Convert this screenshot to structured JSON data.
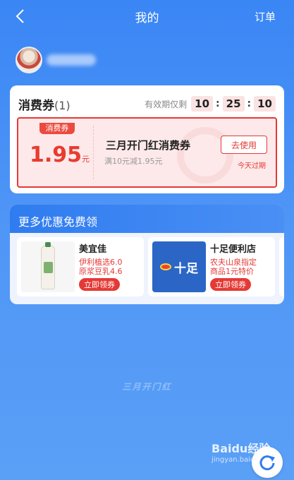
{
  "header": {
    "title": "我的",
    "orders_label": "订单"
  },
  "coupons": {
    "title": "消费券",
    "count": "(1)",
    "validity_label": "有效期仅剩",
    "time": {
      "hours": "10",
      "minutes": "25",
      "seconds": "10"
    },
    "items": [
      {
        "tag": "消费券",
        "amount": "1.95",
        "unit": "元",
        "name": "三月开门红消费券",
        "condition": "满10元减1.95元",
        "use_label": "去使用",
        "expire": "今天过期"
      }
    ]
  },
  "more": {
    "title": "更多优惠免费领",
    "stores": [
      {
        "name": "美宜佳",
        "desc_line1": "伊利植选6.0",
        "desc_line2": "原浆豆乳4.6",
        "button": "立即领券"
      },
      {
        "name": "十足便利店",
        "logo_text": "十足",
        "desc_line1": "农夫山泉指定",
        "desc_line2": "商品1元特价",
        "button": "立即领券"
      }
    ]
  },
  "watermark": {
    "brand": "三月开门红",
    "baidu_line1": "Baidu经验",
    "baidu_line2": "jingyan.baidu.com"
  },
  "colors": {
    "primary_blue": "#3a86f5",
    "coupon_red": "#e53935",
    "coupon_bg": "#fde9ea"
  }
}
